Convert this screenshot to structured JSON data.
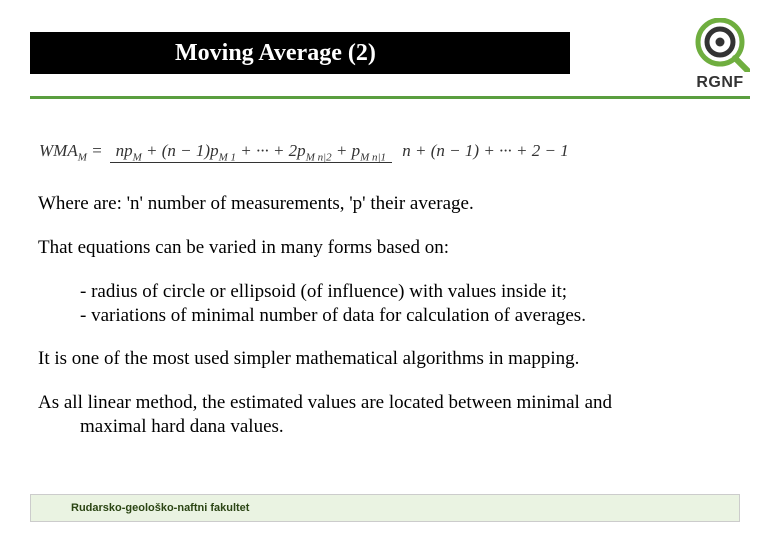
{
  "header": {
    "title": "Moving Average (2)",
    "logo_label": "RGNF"
  },
  "formula": {
    "lhs": "WMA",
    "lhs_sub": "M",
    "numerator": "np_M + (n − 1)p_{M−1} + ··· + 2p_{M−n+2} + p_{M−n+1}",
    "denominator": "n + (n − 1) + ··· + 2 + 1"
  },
  "body": {
    "p1": "Where are: 'n' number of measurements, 'p' their average.",
    "p2": "That equations can be varied in many forms based on:",
    "b1": "- radius of circle or ellipsoid (of influence) with values inside it;",
    "b2": "- variations of minimal number of data for calculation of averages.",
    "p3": "It is one of the most used simpler mathematical algorithms in mapping.",
    "p4": "As all linear method, the estimated values are located between minimal and",
    "p4b": "maximal hard dana values."
  },
  "footer": {
    "text": "Rudarsko-geološko-naftni fakultet"
  }
}
